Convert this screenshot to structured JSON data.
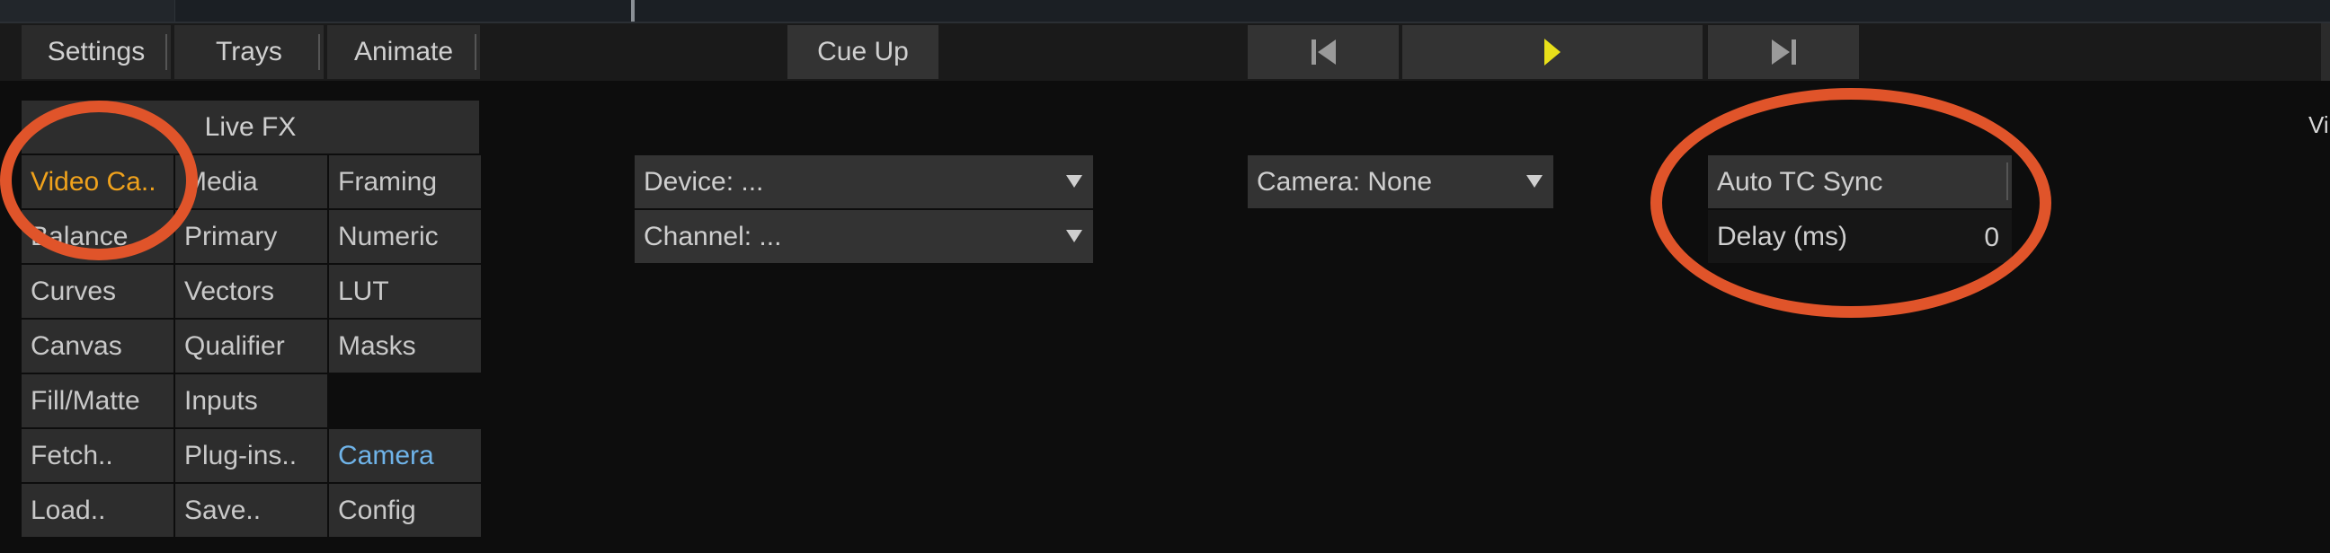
{
  "toolbar": {
    "settings_label": "Settings",
    "trays_label": "Trays",
    "animate_label": "Animate",
    "cue_up_label": "Cue Up"
  },
  "menu": {
    "header": "Live FX",
    "cells": [
      "Video Ca..",
      "Media",
      "Framing",
      "Balance",
      "Primary",
      "Numeric",
      "Curves",
      "Vectors",
      "LUT",
      "Canvas",
      "Qualifier",
      "Masks",
      "Fill/Matte",
      "Inputs",
      "Fetch..",
      "Plug-ins..",
      "Camera",
      "Load..",
      "Save..",
      "Config"
    ]
  },
  "video_capture": {
    "device_label": "Device: ...",
    "channel_label": "Channel: ...",
    "camera_label": "Camera: None",
    "auto_tc_sync_label": "Auto TC Sync",
    "delay_label": "Delay (ms)",
    "delay_value": "0"
  },
  "edge_text": "Vi",
  "annotation_color": "#e0542a",
  "icons": {
    "prev": "skip-back-icon",
    "play": "play-icon",
    "next": "skip-forward-icon"
  }
}
